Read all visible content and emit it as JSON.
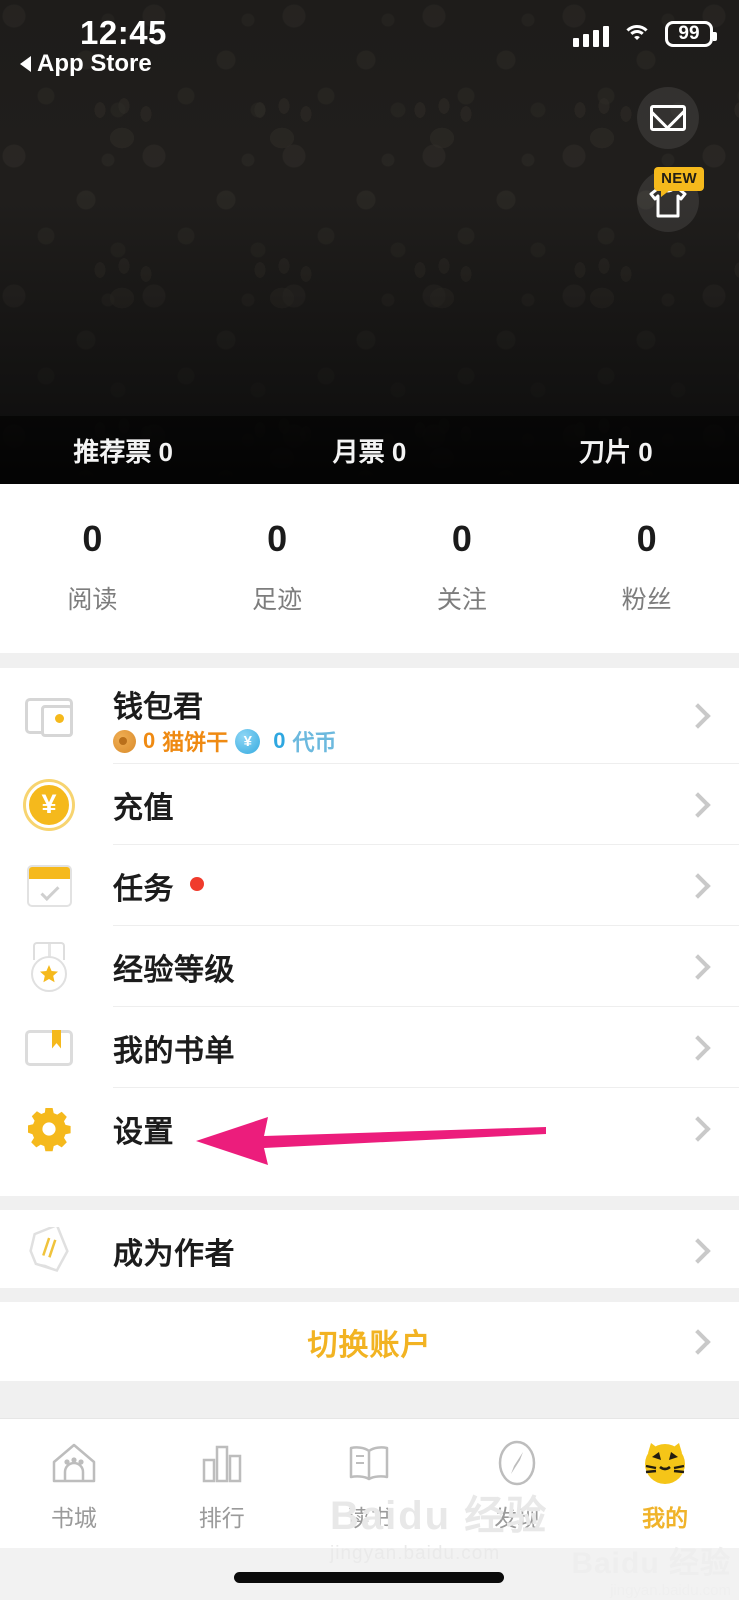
{
  "status_bar": {
    "time": "12:45",
    "back_label": "App Store",
    "battery": "99",
    "signal_icon": "signal-bars-icon",
    "wifi_icon": "wifi-icon",
    "battery_icon": "battery-icon"
  },
  "header": {
    "mail_button_icon": "mail-envelope-icon",
    "shirt_button_icon": "t-shirt-icon",
    "new_badge": "NEW",
    "votes": [
      {
        "label": "推荐票 0"
      },
      {
        "label": "月票 0"
      },
      {
        "label": "刀片 0"
      }
    ]
  },
  "stats": [
    {
      "value": "0",
      "label": "阅读"
    },
    {
      "value": "0",
      "label": "足迹"
    },
    {
      "value": "0",
      "label": "关注"
    },
    {
      "value": "0",
      "label": "粉丝"
    }
  ],
  "wallet": {
    "icon": "wallet-icon",
    "title": "钱包君",
    "cookie_icon": "cookie-coin-icon",
    "cookie_value": "0",
    "cookie_label": "猫饼干",
    "token_icon": "yen-coin-icon",
    "token_symbol": "¥",
    "token_value": "0",
    "token_label": "代币"
  },
  "menu": [
    {
      "icon": "yen-coin-icon",
      "label": "充值",
      "badge": false
    },
    {
      "icon": "calendar-check-icon",
      "label": "任务",
      "badge": true
    },
    {
      "icon": "medal-star-icon",
      "label": "经验等级",
      "badge": false
    },
    {
      "icon": "bookmark-card-icon",
      "label": "我的书单",
      "badge": false
    },
    {
      "icon": "gear-icon",
      "label": "设置",
      "badge": false
    }
  ],
  "author_row": {
    "icon": "pencil-icon",
    "label": "成为作者"
  },
  "switch_account": {
    "label": "切换账户"
  },
  "tabbar": [
    {
      "icon": "house-icon",
      "label": "书城",
      "active": false
    },
    {
      "icon": "bar-chart-icon",
      "label": "排行",
      "active": false
    },
    {
      "icon": "open-book-icon",
      "label": "读书",
      "active": false
    },
    {
      "icon": "compass-icon",
      "label": "发现",
      "active": false
    },
    {
      "icon": "cat-face-icon",
      "label": "我的",
      "active": true
    }
  ],
  "annotation": {
    "arrow_color": "#ec1d7c",
    "target": "设置"
  },
  "watermark": {
    "brand": "Baidu 经验",
    "url": "jingyan.baidu.com"
  },
  "colors": {
    "accent_yellow": "#f5b91c",
    "header_dark": "#211f1d",
    "orange": "#ef8a12",
    "blue": "#2ea7e0",
    "red_dot": "#f03b2c",
    "arrow_pink": "#ec1d7c"
  }
}
